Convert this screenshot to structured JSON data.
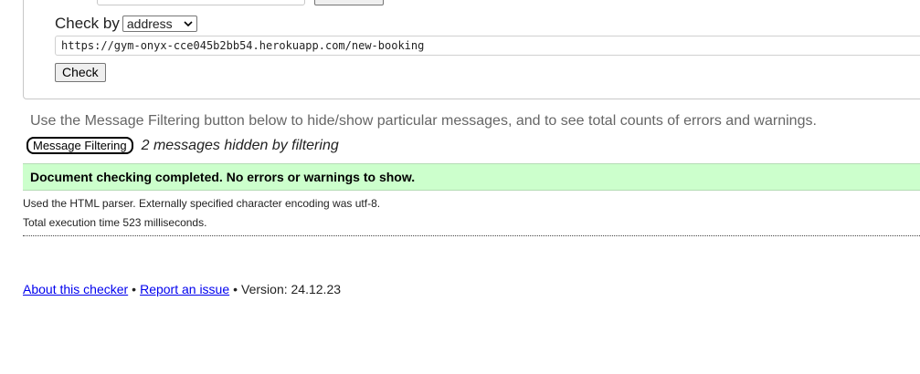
{
  "form": {
    "check_by_label": "Check by",
    "check_by_selected": "address",
    "url_value": "https://gym-onyx-cce045b2bb54.herokuapp.com/new-booking",
    "check_button_label": "Check"
  },
  "filtering": {
    "hint_text": "Use the Message Filtering button below to hide/show particular messages, and to see total counts of errors and warnings.",
    "button_label": "Message Filtering",
    "hidden_text": "2 messages hidden by filtering"
  },
  "result": {
    "success_text": "Document checking completed. No errors or warnings to show.",
    "parser_info": "Used the HTML parser. Externally specified character encoding was utf-8.",
    "execution_time": "Total execution time 523 milliseconds."
  },
  "footer": {
    "about_link": "About this checker",
    "bullet": "•",
    "report_link": "Report an issue",
    "version_text": "Version: 24.12.23"
  },
  "icons": {
    "select_chevron": "chevron-down-icon"
  },
  "colors": {
    "success_background": "#ccffcc",
    "link": "#0000ee",
    "hint_text": "#666666"
  }
}
